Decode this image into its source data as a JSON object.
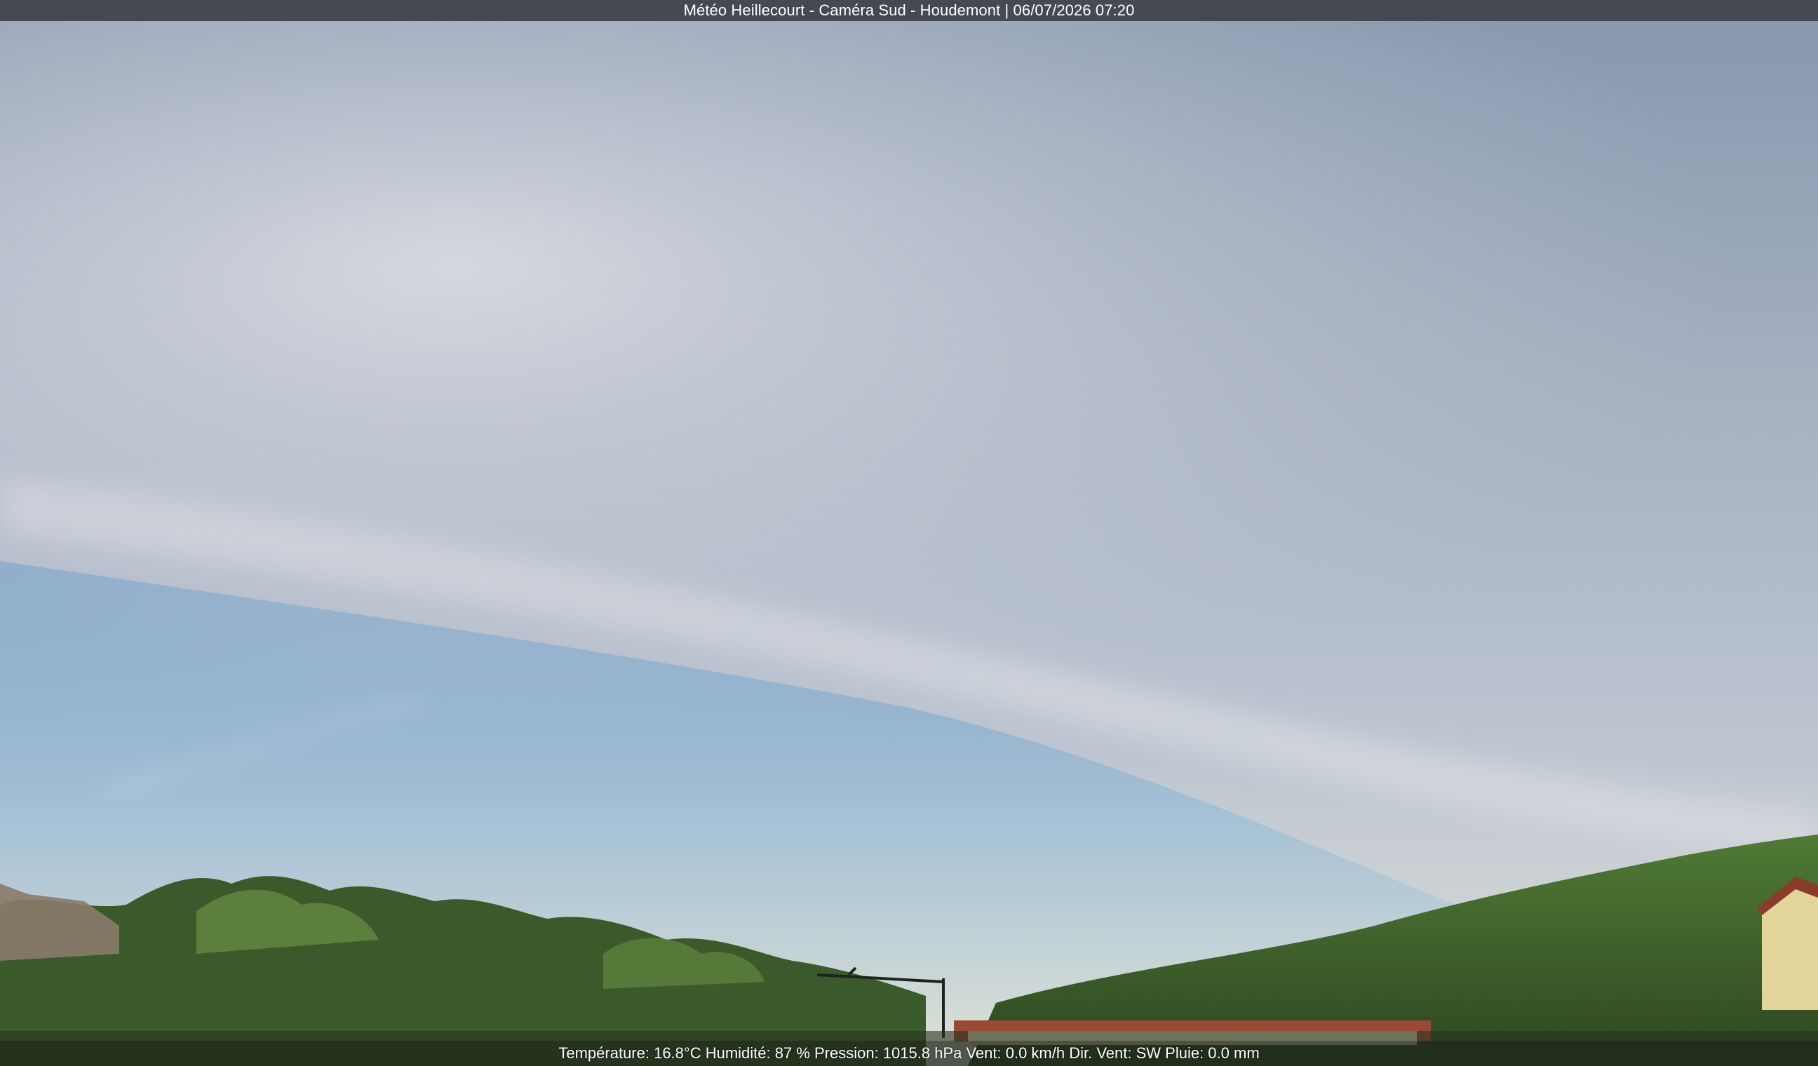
{
  "camera": {
    "title": "Météo Heillecourt - Caméra Sud - Houdemont | 06/07/2026 07:20"
  },
  "weather": {
    "line": "Température: 16.8°C  Humidité: 87 % Pression: 1015.8 hPa Vent: 0.0 km/h Dir. Vent: SW Pluie: 0.0 mm"
  },
  "palette": {
    "sky_top": "#8e9db5",
    "sky_mid": "#b3bccb",
    "sky_clear": "#9ab8d3",
    "horizon": "#d9dcd6",
    "cloud": "#d2d6de",
    "trees_dark": "#2f4a26",
    "trees_light": "#5f8a3e",
    "roof": "#9a4a34",
    "house": "#e3d49a"
  }
}
